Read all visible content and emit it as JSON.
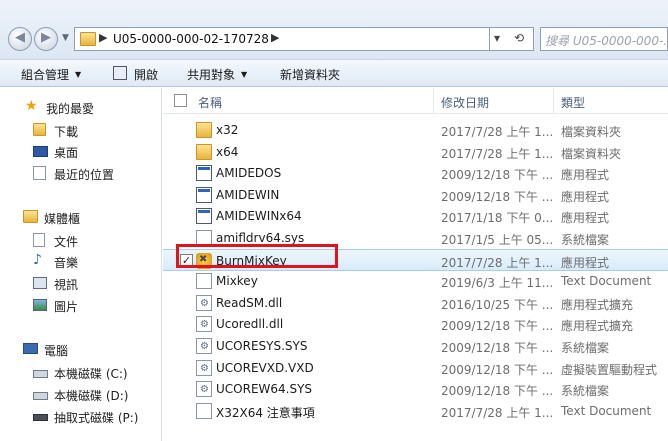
{
  "address": {
    "path": "U05-0000-000-02-170728",
    "search_placeholder": "搜尋 U05-0000-000-..."
  },
  "toolbar": {
    "organize": "組合管理",
    "open": "開啟",
    "share": "共用對象",
    "new_folder": "新增資料夾"
  },
  "nav": {
    "favorites": "我的最愛",
    "downloads": "下載",
    "desktop": "桌面",
    "recent": "最近的位置",
    "libraries": "媒體櫃",
    "documents": "文件",
    "music": "音樂",
    "videos": "視訊",
    "pictures": "圖片",
    "computer": "電腦",
    "drive_c": "本機磁碟 (C:)",
    "drive_d": "本機磁碟 (D:)",
    "drive_p": "抽取式磁碟 (P:)"
  },
  "columns": {
    "name": "名稱",
    "date": "修改日期",
    "type": "類型"
  },
  "files": [
    {
      "name": "x32",
      "date": "2017/7/28 上午 1...",
      "type": "檔案資料夾",
      "icon": "folder"
    },
    {
      "name": "x64",
      "date": "2017/7/28 上午 1...",
      "type": "檔案資料夾",
      "icon": "folder"
    },
    {
      "name": "AMIDEDOS",
      "date": "2009/12/18 下午 ...",
      "type": "應用程式",
      "icon": "app"
    },
    {
      "name": "AMIDEWIN",
      "date": "2009/12/18 下午 ...",
      "type": "應用程式",
      "icon": "app"
    },
    {
      "name": "AMIDEWINx64",
      "date": "2017/1/18 下午 0...",
      "type": "應用程式",
      "icon": "app"
    },
    {
      "name": "amifldrv64.sys",
      "date": "2017/1/5 上午 05...",
      "type": "系統檔案",
      "icon": "doc"
    },
    {
      "name": "BurnMixKey",
      "date": "2017/7/28 上午 1...",
      "type": "應用程式",
      "icon": "burn",
      "checkbox": "✓"
    },
    {
      "name": "Mixkey",
      "date": "2019/6/3 上午 11...",
      "type": "Text Document",
      "icon": "doc"
    },
    {
      "name": "ReadSM.dll",
      "date": "2016/10/25 下午 ...",
      "type": "應用程式擴充",
      "icon": "dll"
    },
    {
      "name": "Ucoredll.dll",
      "date": "2009/12/18 下午 ...",
      "type": "應用程式擴充",
      "icon": "dll"
    },
    {
      "name": "UCORESYS.SYS",
      "date": "2009/12/18 下午 ...",
      "type": "系統檔案",
      "icon": "dll"
    },
    {
      "name": "UCOREVXD.VXD",
      "date": "2009/12/18 下午 ...",
      "type": "虛擬裝置驅動程式",
      "icon": "dll"
    },
    {
      "name": "UCOREW64.SYS",
      "date": "2009/12/18 下午 ...",
      "type": "系統檔案",
      "icon": "dll"
    },
    {
      "name": "X32X64 注意事項",
      "date": "2017/7/28 上午 1...",
      "type": "Text Document",
      "icon": "doc"
    }
  ]
}
